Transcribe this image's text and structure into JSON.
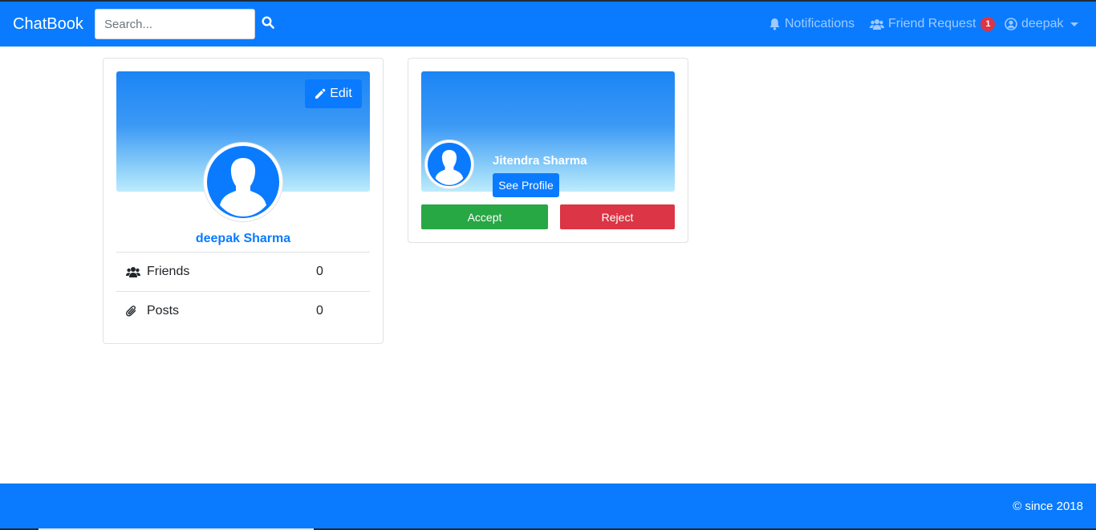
{
  "navbar": {
    "brand": "ChatBook",
    "search_placeholder": "Search...",
    "notifications_label": "Notifications",
    "friend_request_label": "Friend Request",
    "friend_request_count": "1",
    "user_label": "deepak"
  },
  "profile": {
    "edit_label": "Edit",
    "name": "deepak Sharma",
    "stats": {
      "friends_label": "Friends",
      "friends_value": "0",
      "posts_label": "Posts",
      "posts_value": "0"
    }
  },
  "request": {
    "name": "Jitendra Sharma",
    "see_profile_label": "See Profile",
    "accept_label": "Accept",
    "reject_label": "Reject"
  },
  "footer": {
    "text": "© since 2018"
  },
  "colors": {
    "primary": "#0a7bff",
    "success": "#28a745",
    "danger": "#dc3545"
  },
  "icons": [
    "search-icon",
    "bell-icon",
    "users-icon",
    "user-circle-icon",
    "pencil-icon",
    "paperclip-icon",
    "avatar-silhouette-icon"
  ]
}
